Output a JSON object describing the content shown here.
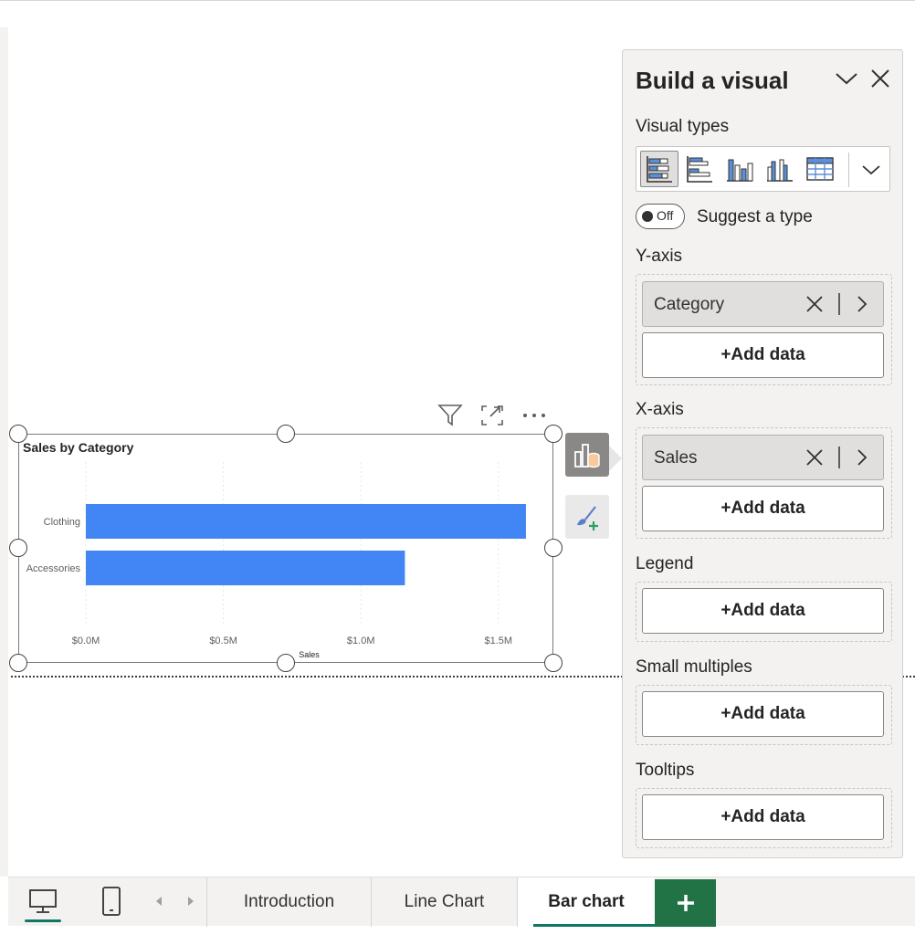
{
  "visual": {
    "title": "Sales by Category",
    "toolbar": {
      "filter_icon": "filter-icon",
      "focus_icon": "focus-mode-icon",
      "more_icon": "more-options-icon"
    }
  },
  "chart_data": {
    "type": "bar",
    "orientation": "horizontal",
    "title": "Sales by Category",
    "categories": [
      "Clothing",
      "Accessories"
    ],
    "values": [
      1.6,
      1.16
    ],
    "value_unit": "$M",
    "xlabel": "Sales",
    "ylabel": "",
    "xlim": [
      0,
      1.65
    ],
    "x_ticks": [
      "$0.0M",
      "$0.5M",
      "$1.0M",
      "$1.5M"
    ],
    "x_tick_values": [
      0,
      0.5,
      1.0,
      1.5
    ],
    "bar_color": "#4285f4",
    "grid": true
  },
  "panel": {
    "title": "Build a visual",
    "visual_types_label": "Visual types",
    "visual_type_icons": [
      "stacked-bar-chart-icon",
      "clustered-bar-chart-icon",
      "stacked-column-chart-icon",
      "clustered-column-chart-icon",
      "table-icon"
    ],
    "toggle_text": "Off",
    "suggest_label": "Suggest a type",
    "y_axis": {
      "label": "Y-axis",
      "field": "Category",
      "add_label": "+Add data"
    },
    "x_axis": {
      "label": "X-axis",
      "field": "Sales",
      "add_label": "+Add data"
    },
    "legend": {
      "label": "Legend",
      "add_label": "+Add data"
    },
    "small_multiples": {
      "label": "Small multiples",
      "add_label": "+Add data"
    },
    "tooltips": {
      "label": "Tooltips",
      "add_label": "+Add data"
    }
  },
  "bottom": {
    "tabs": [
      "Introduction",
      "Line Chart",
      "Bar chart"
    ],
    "active_tab": "Bar chart",
    "add_page_label": "+"
  },
  "colors": {
    "accent": "#117865",
    "add_page": "#217346",
    "bar": "#4285f4"
  }
}
